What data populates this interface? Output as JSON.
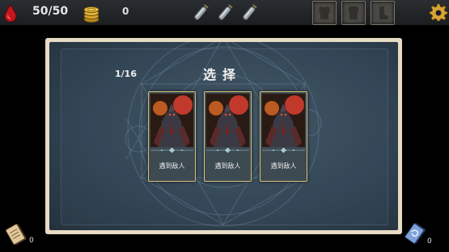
{
  "topbar": {
    "hp": "50/50",
    "gold": "0",
    "potions": [
      "empty-potion-icon",
      "empty-potion-icon",
      "empty-potion-icon"
    ],
    "relic_slots": [
      "armor-slot-icon",
      "chest-slot-icon",
      "boots-slot-icon"
    ],
    "settings_icon": "gear-icon"
  },
  "event": {
    "progress": "1/16",
    "title": "选择",
    "cards": [
      {
        "label": "遇到敌人"
      },
      {
        "label": "遇到敌人"
      },
      {
        "label": "遇到敌人"
      }
    ]
  },
  "footer": {
    "draw_pile_count": "0",
    "discard_pile_count": "0"
  },
  "colors": {
    "panel_border": "#e6dcc4",
    "panel_bg": "#2f4150",
    "card_border": "#d9c27a",
    "hp_red": "#c4161c",
    "gold": "#d6a72d"
  }
}
